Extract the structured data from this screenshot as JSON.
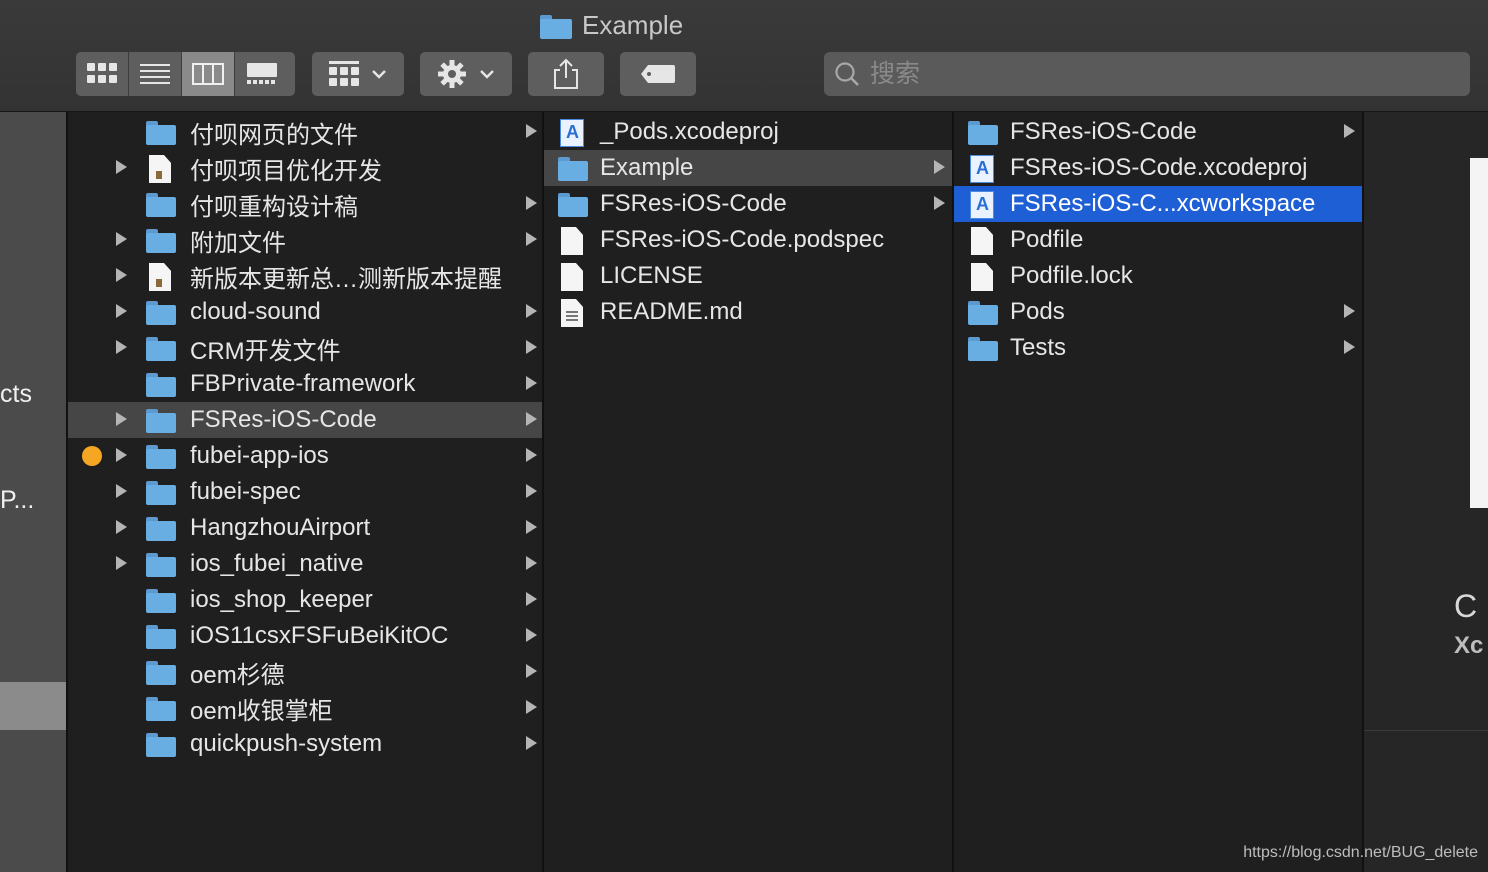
{
  "window": {
    "title": "Example"
  },
  "toolbar": {
    "search_placeholder": "搜索"
  },
  "sidebar": {
    "partial_labels": [
      "cts",
      "P..."
    ]
  },
  "column1": {
    "rows": [
      {
        "name": "付呗网页的文件",
        "icon": "folder",
        "arrow": true,
        "left_arrow": false,
        "selected": false
      },
      {
        "name": "付呗项目优化开发",
        "icon": "document",
        "arrow": false,
        "left_arrow": true,
        "selected": false
      },
      {
        "name": "付呗重构设计稿",
        "icon": "folder",
        "arrow": true,
        "left_arrow": false,
        "selected": false
      },
      {
        "name": "附加文件",
        "icon": "folder",
        "arrow": true,
        "left_arrow": true,
        "selected": false
      },
      {
        "name": "新版本更新总…测新版本提醒",
        "icon": "document",
        "arrow": false,
        "left_arrow": true,
        "selected": false
      },
      {
        "name": "cloud-sound",
        "icon": "folder",
        "arrow": true,
        "left_arrow": true,
        "selected": false
      },
      {
        "name": "CRM开发文件",
        "icon": "folder",
        "arrow": true,
        "left_arrow": true,
        "selected": false
      },
      {
        "name": "FBPrivate-framework",
        "icon": "folder",
        "arrow": true,
        "left_arrow": false,
        "selected": false
      },
      {
        "name": "FSRes-iOS-Code",
        "icon": "folder",
        "arrow": true,
        "left_arrow": true,
        "selected": true
      },
      {
        "name": "fubei-app-ios",
        "icon": "folder",
        "arrow": true,
        "left_arrow": true,
        "selected": false,
        "tag_color": "#f5a623"
      },
      {
        "name": "fubei-spec",
        "icon": "folder",
        "arrow": true,
        "left_arrow": true,
        "selected": false
      },
      {
        "name": "HangzhouAirport",
        "icon": "folder",
        "arrow": true,
        "left_arrow": true,
        "selected": false
      },
      {
        "name": "ios_fubei_native",
        "icon": "folder",
        "arrow": true,
        "left_arrow": true,
        "selected": false
      },
      {
        "name": "ios_shop_keeper",
        "icon": "folder",
        "arrow": true,
        "left_arrow": false,
        "selected": false
      },
      {
        "name": "iOS11csxFSFuBeiKitOC",
        "icon": "folder",
        "arrow": true,
        "left_arrow": false,
        "selected": false
      },
      {
        "name": "oem杉德",
        "icon": "folder",
        "arrow": true,
        "left_arrow": false,
        "selected": false
      },
      {
        "name": "oem收银掌柜",
        "icon": "folder",
        "arrow": true,
        "left_arrow": false,
        "selected": false
      },
      {
        "name": "quickpush-system",
        "icon": "folder",
        "arrow": true,
        "left_arrow": false,
        "selected": false
      }
    ]
  },
  "column2": {
    "rows": [
      {
        "name": "_Pods.xcodeproj",
        "icon": "xcodeproj",
        "arrow": false,
        "selected": false
      },
      {
        "name": "Example",
        "icon": "folder",
        "arrow": true,
        "selected": true
      },
      {
        "name": "FSRes-iOS-Code",
        "icon": "folder",
        "arrow": true,
        "selected": false
      },
      {
        "name": "FSRes-iOS-Code.podspec",
        "icon": "blank",
        "arrow": false,
        "selected": false
      },
      {
        "name": "LICENSE",
        "icon": "blank",
        "arrow": false,
        "selected": false
      },
      {
        "name": "README.md",
        "icon": "text",
        "arrow": false,
        "selected": false
      }
    ]
  },
  "column3": {
    "rows": [
      {
        "name": "FSRes-iOS-Code",
        "icon": "folder",
        "arrow": true,
        "selected": false
      },
      {
        "name": "FSRes-iOS-Code.xcodeproj",
        "icon": "xcodeproj",
        "arrow": false,
        "selected": false
      },
      {
        "name": "FSRes-iOS-C...xcworkspace",
        "icon": "xcodeproj",
        "arrow": false,
        "selected": true
      },
      {
        "name": "Podfile",
        "icon": "blank",
        "arrow": false,
        "selected": false
      },
      {
        "name": "Podfile.lock",
        "icon": "blank",
        "arrow": false,
        "selected": false
      },
      {
        "name": "Pods",
        "icon": "folder",
        "arrow": true,
        "selected": false
      },
      {
        "name": "Tests",
        "icon": "folder",
        "arrow": true,
        "selected": false
      }
    ]
  },
  "preview": {
    "line1": "C",
    "line2": "Xc"
  },
  "watermark": "https://blog.csdn.net/BUG_delete",
  "colors": {
    "selection_blue": "#1f5fd6",
    "folder_blue": "#69aee3",
    "tag_orange": "#f5a623"
  }
}
